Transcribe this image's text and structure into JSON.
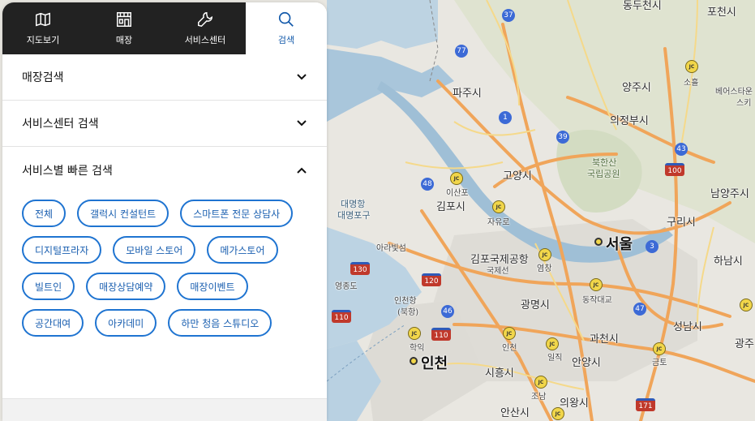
{
  "nav": {
    "tabs": [
      {
        "label": "지도보기",
        "icon": "map-icon"
      },
      {
        "label": "매장",
        "icon": "store-icon"
      },
      {
        "label": "서비스센터",
        "icon": "wrench-icon"
      },
      {
        "label": "검색",
        "icon": "search-icon",
        "active": true
      }
    ]
  },
  "accordions": [
    {
      "title": "매장검색",
      "state": "collapsed"
    },
    {
      "title": "서비스센터 검색",
      "state": "collapsed"
    },
    {
      "title": "서비스별 빠른 검색",
      "state": "expanded"
    }
  ],
  "chips": [
    "전체",
    "갤럭시 컨설턴트",
    "스마트폰 전문 상담사",
    "디지털프라자",
    "모바일 스토어",
    "메가스토어",
    "빌트인",
    "매장상담예약",
    "매장이벤트",
    "공간대여",
    "아카데미",
    "하만 청음 스튜디오"
  ],
  "colors": {
    "accent": "#1f74d1",
    "nav_bg": "#222222",
    "active_tab_text": "#1259aa"
  },
  "map": {
    "labels": {
      "dongducheon": "동두천시",
      "pocheon": "포천시",
      "paju": "파주시",
      "yangju": "양주시",
      "uijeongbu": "의정부시",
      "goyang": "고양시",
      "bukhansan": "북한산",
      "bukhansan2": "국립공원",
      "namyangju": "남양주시",
      "gimpo": "김포시",
      "daemyeong": "대명항",
      "daemyeongport": "대명포구",
      "guri": "구리시",
      "seoul": "서울",
      "airport1": "김포국제공항",
      "airport2": "국제선",
      "arabit": "아라빛섬",
      "hanam": "하남시",
      "yeongjong": "영종도",
      "incheonport": "인천항",
      "incheonport2": "(북항)",
      "gwangmyeong": "광명시",
      "seongnam": "성남시",
      "gwacheon": "과천시",
      "incheon": "인천",
      "siheung": "시흥시",
      "anyang": "안양시",
      "uiwang": "의왕시",
      "ansan": "안산시",
      "soheul": "소흘",
      "gwangju": "광주",
      "bears": "베어스타운",
      "ski": "스키",
      "isanpo": "이산포",
      "jayuro": "자유로",
      "yeomchang": "염창",
      "dongjak": "동작대교",
      "hakik": "학익",
      "ilji": "일직",
      "geumto": "금토",
      "incheonjc": "인천",
      "joam": "조남"
    },
    "routes": [
      "37",
      "77",
      "1",
      "39",
      "43",
      "100",
      "48",
      "130",
      "120",
      "3",
      "46",
      "110",
      "110",
      "47",
      "171"
    ]
  }
}
